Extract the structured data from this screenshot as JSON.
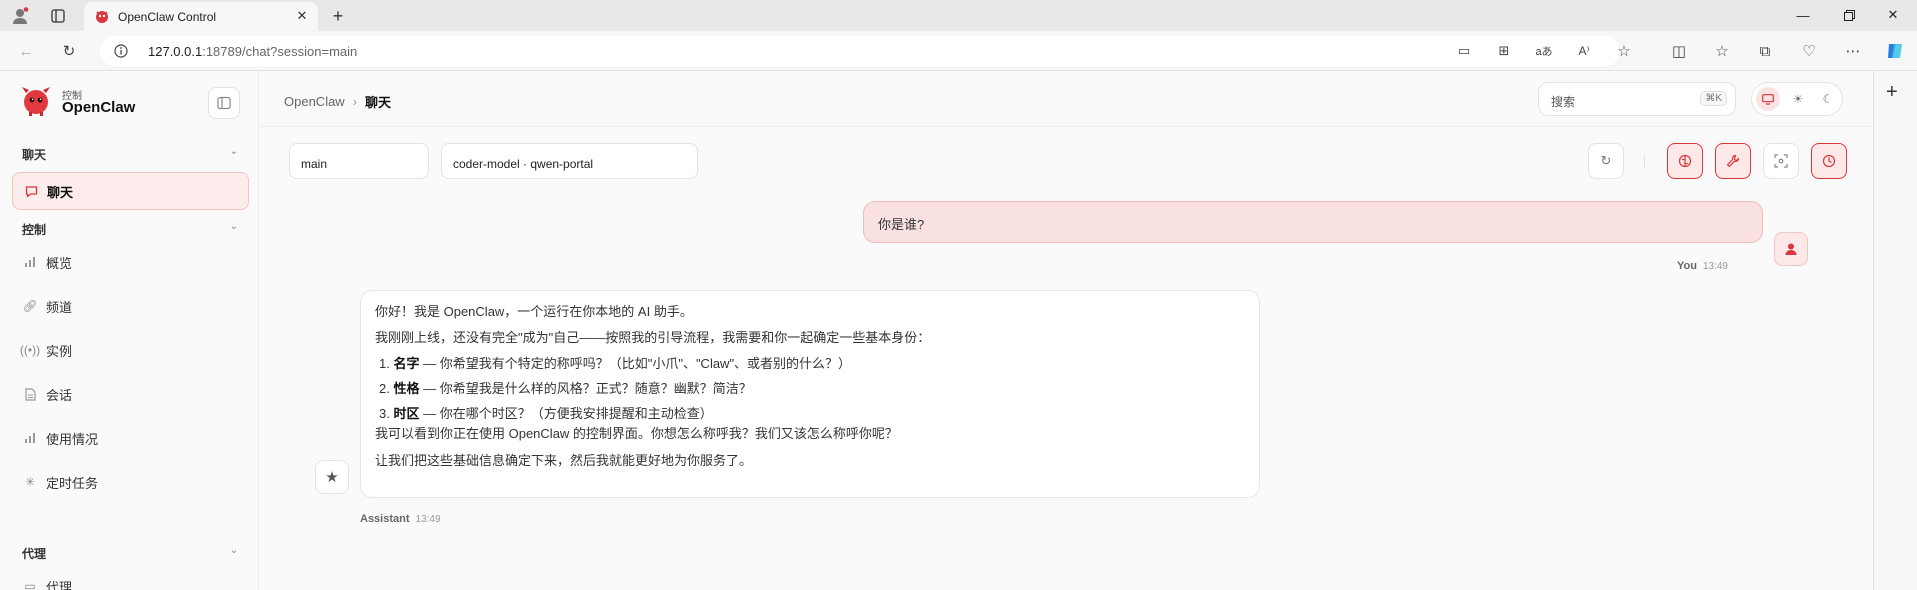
{
  "browser": {
    "tab_title": "OpenClaw Control",
    "url_host": "127.0.0.1",
    "url_path": ":18789/chat?session=main"
  },
  "sidebar": {
    "brand_sub": "控制",
    "brand_name": "OpenClaw",
    "groups": [
      {
        "label": "聊天",
        "items": [
          {
            "label": "聊天",
            "icon": "chat-bubble-icon",
            "active": true
          }
        ]
      },
      {
        "label": "控制",
        "items": [
          {
            "label": "概览",
            "icon": "bar-chart-icon"
          },
          {
            "label": "频道",
            "icon": "link-icon"
          },
          {
            "label": "实例",
            "icon": "broadcast-icon"
          },
          {
            "label": "会话",
            "icon": "document-icon"
          },
          {
            "label": "使用情况",
            "icon": "bar-chart-icon"
          },
          {
            "label": "定时任务",
            "icon": "loader-icon"
          }
        ]
      },
      {
        "label": "代理",
        "items": [
          {
            "label": "代理",
            "icon": "folder-icon"
          }
        ]
      }
    ]
  },
  "header": {
    "breadcrumb_root": "OpenClaw",
    "breadcrumb_sep": "›",
    "breadcrumb_current": "聊天",
    "search_placeholder": "搜索",
    "search_shortcut": "⌘K",
    "theme_options": [
      "system",
      "light",
      "dark"
    ],
    "theme_selected": "system"
  },
  "toolbar": {
    "session_value": "main",
    "model_value": "coder-model · qwen-portal"
  },
  "messages": [
    {
      "role": "user",
      "author": "You",
      "time": "13:49",
      "text": "你是谁?"
    },
    {
      "role": "assistant",
      "author": "Assistant",
      "time": "13:49",
      "intro": "你好！我是 OpenClaw，一个运行在你本地的 AI 助手。",
      "line2": "我刚刚上线，还没有完全\"成为\"自己——按照我的引导流程，我需要和你一起确定一些基本身份：",
      "list": [
        {
          "num": "1.",
          "term": "名字",
          "text": " — 你希望我有个特定的称呼吗？（比如\"小爪\"、\"Claw\"、或者别的什么？）"
        },
        {
          "num": "2.",
          "term": "性格",
          "text": " — 你希望我是什么样的风格？正式？随意？幽默？简洁？"
        },
        {
          "num": "3.",
          "term": "时区",
          "text": " — 你在哪个时区？（方便我安排提醒和主动检查）"
        }
      ],
      "line3": "我可以看到你正在使用 OpenClaw 的控制界面。你想怎么称呼我？我们又该怎么称呼你呢？",
      "line4": "让我们把这些基础信息确定下来，然后我就能更好地为你服务了。"
    }
  ],
  "colors": {
    "accent": "#d9363e",
    "accent_soft": "#fae1e1"
  }
}
